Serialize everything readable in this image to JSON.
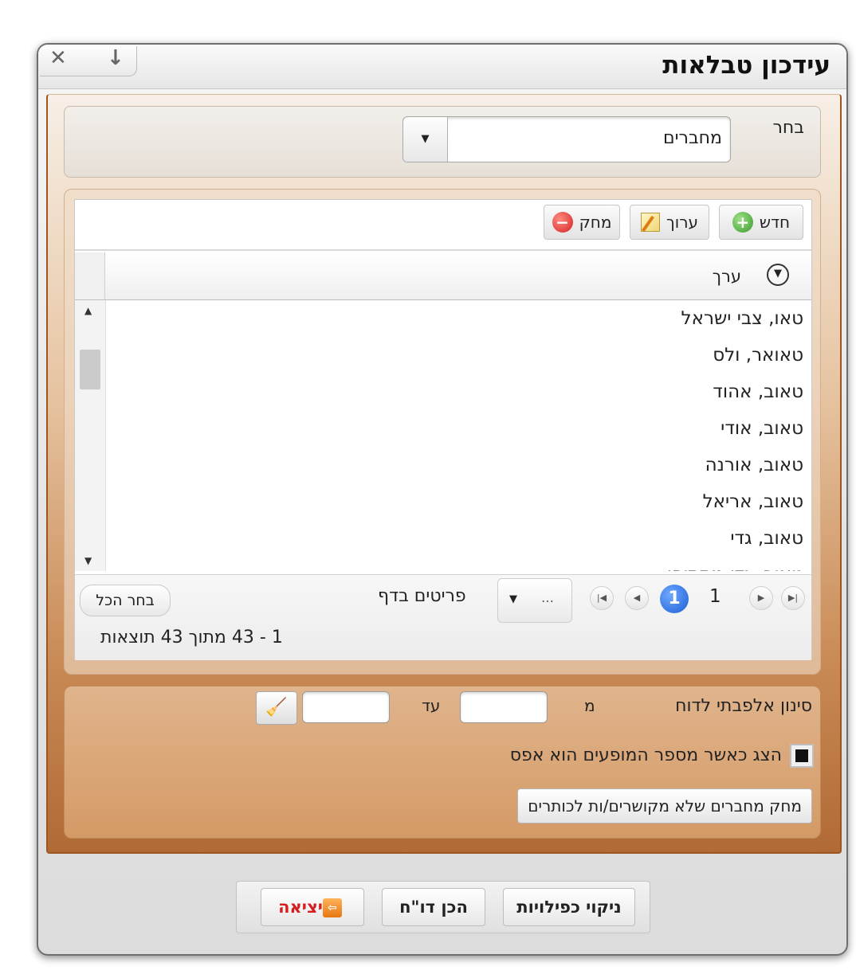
{
  "window": {
    "title": "עידכון טבלאות"
  },
  "select_panel": {
    "label": "בחר",
    "value": "מחברים",
    "dropdown_arrow": "▼"
  },
  "toolbar": {
    "new_label": "חדש",
    "edit_label": "ערוך",
    "delete_label": "מחק"
  },
  "grid": {
    "column_header": "ערך",
    "rows": [
      "טאו, צבי ישראל",
      "טאואר, ולס",
      "טאוב, אהוד",
      "טאוב, אודי",
      "טאוב, אורנה",
      "טאוב, אריאל",
      "טאוב, גדי",
      "טאוב, גדי מתתיהו"
    ]
  },
  "pager": {
    "current_page": "1",
    "total_pages": "1",
    "page_size_value": "…",
    "items_per_page_label": "פריטים בדף",
    "select_all_label": "בחר הכל",
    "results_text": "1 - 43 מתוך 43 תוצאות"
  },
  "filter_panel": {
    "label": "סינון אלפבתי לדוח",
    "from_label": "מ",
    "to_label": "עד",
    "from_value": "",
    "to_value": "",
    "show_zero_label": "הצג כאשר מספר המופעים הוא אפס",
    "show_zero_checked": true,
    "delete_unlinked_label": "מחק מחברים שלא מקושרים/ות לכותרים"
  },
  "footer": {
    "exit_label": "יציאה",
    "report_label": "הכן דו\"ח",
    "dedupe_label": "ניקוי כפילויות"
  }
}
